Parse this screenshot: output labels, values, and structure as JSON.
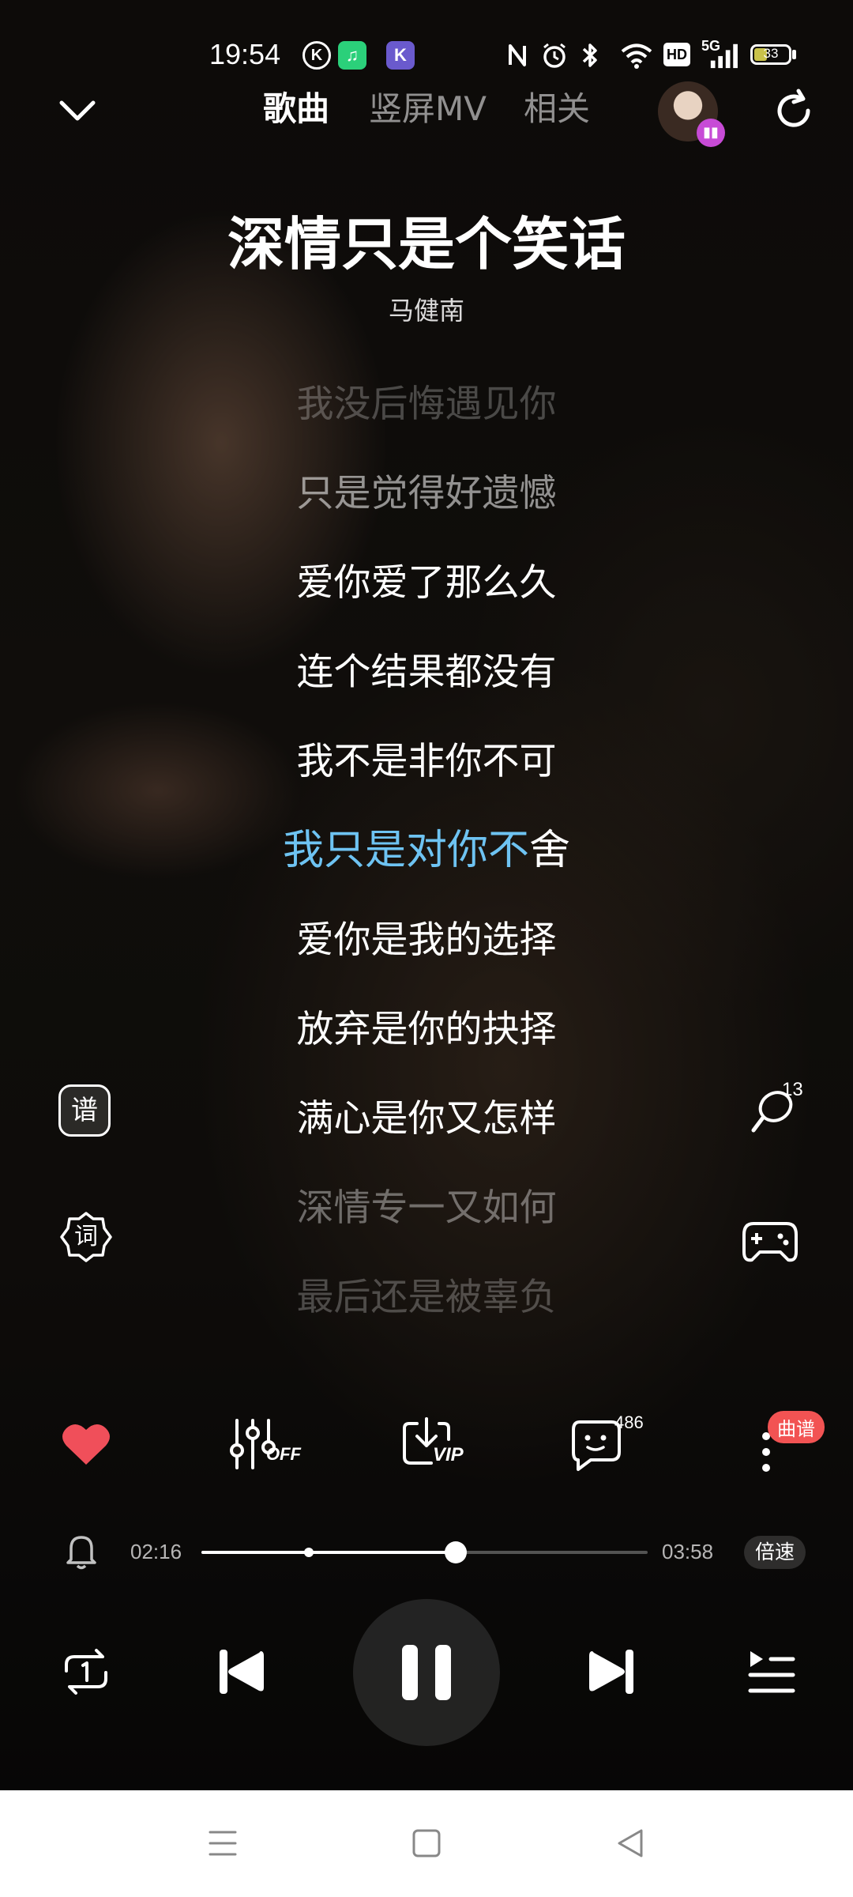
{
  "status_bar": {
    "time": "19:54",
    "app_badges": [
      {
        "icon": "k-circle-icon",
        "glyph": "K",
        "color": "#ffffff"
      },
      {
        "icon": "green-app-icon",
        "glyph": "♫",
        "color": "#2bd07a"
      },
      {
        "icon": "purple-k-icon",
        "glyph": "K",
        "color": "#6a5acd"
      }
    ],
    "hd_label": "HD",
    "network": "5G",
    "battery": "33"
  },
  "header": {
    "tabs": [
      {
        "label": "歌曲",
        "active": true
      },
      {
        "label": "竖屏MV",
        "active": false
      },
      {
        "label": "相关",
        "active": false
      }
    ]
  },
  "song": {
    "title": "深情只是个笑话",
    "artist": "马健南"
  },
  "lyrics": {
    "lines": [
      "我没后悔遇见你",
      "只是觉得好遗憾",
      "爱你爱了那么久",
      "连个结果都没有",
      "我不是非你不可"
    ],
    "current_sung": "我只是对你不",
    "current_rest": "舍",
    "after": [
      "爱你是我的选择",
      "放弃是你的抉择",
      "满心是你又怎样",
      "深情专一又如何",
      "最后还是被辜负"
    ]
  },
  "side": {
    "left_top": "谱",
    "left_bottom": "词",
    "right_top_count": "13"
  },
  "actions": {
    "eq_label": "OFF",
    "download_label": "VIP",
    "comment_count": "486",
    "more_tag": "曲谱",
    "like_color": "#f04f5a"
  },
  "progress": {
    "current": "02:16",
    "total": "03:58",
    "fraction": 0.57,
    "marker_fraction": 0.24,
    "speed_label": "倍速"
  },
  "colors": {
    "accent_lyric": "#6ec3f2",
    "tag_red": "#f25353"
  }
}
